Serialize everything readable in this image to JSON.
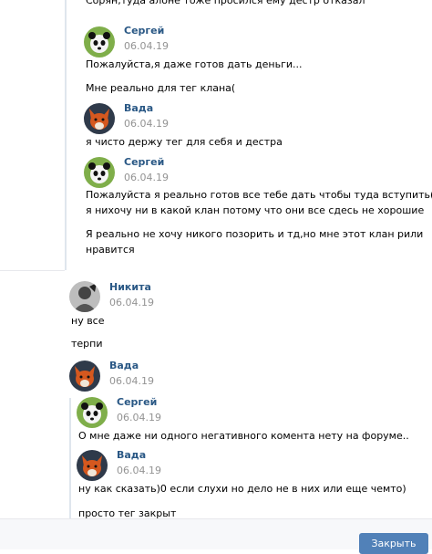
{
  "top_partial_text": "Сорян,туда алоне тоже просился ему дестр отказал",
  "messages": [
    {
      "name": "Сергей",
      "date": "06.04.19",
      "lines": [
        "Пожалуйста,я даже готов дать деньги...",
        "Мне реально для тег клана("
      ]
    },
    {
      "name": "Вада",
      "date": "06.04.19",
      "lines": [
        "я чисто держу тег для себя и дестра"
      ]
    },
    {
      "name": "Сергей",
      "date": "06.04.19",
      "lines": [
        "Пожалуйста я реально готов все тебе дать чтобы туда вступить(",
        "я нихочу ни в какой клан потому что они все сдесь не хорошие",
        "Я реально не хочу никого позорить и тд,но мне этот клан рили",
        "нравится"
      ]
    },
    {
      "name": "Никита",
      "date": "06.04.19",
      "lines": [
        "ну все",
        "терпи"
      ]
    },
    {
      "name": "Вада",
      "date": "06.04.19",
      "lines": []
    },
    {
      "name": "Сергей",
      "date": "06.04.19",
      "lines": [
        "О мне даже ни одного негативного комента нету на форуме.."
      ]
    },
    {
      "name": "Вада",
      "date": "06.04.19",
      "lines": [
        "ну как сказать)0 если слухи но дело не в них или еще чемто)",
        "просто тег закрыт"
      ]
    }
  ],
  "footer": {
    "close_label": "Закрыть"
  }
}
